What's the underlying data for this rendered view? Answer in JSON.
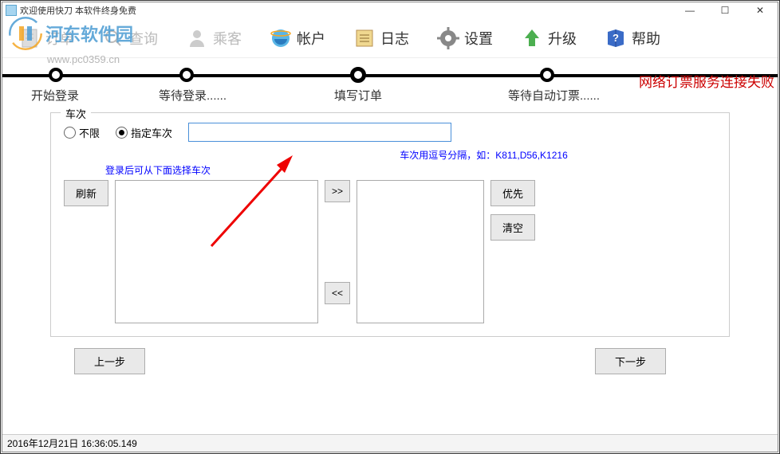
{
  "window": {
    "title": "欢迎使用快刀  本软件终身免费"
  },
  "toolbar": {
    "order": "订单",
    "query": "查询",
    "passenger": "乘客",
    "account": "帐户",
    "log": "日志",
    "settings": "设置",
    "upgrade": "升级",
    "help": "帮助"
  },
  "watermark": {
    "brand": "河东软件园",
    "url": "www.pc0359.cn"
  },
  "stepper": {
    "s1": "开始登录",
    "s2": "等待登录......",
    "s3": "填写订单",
    "s4": "等待自动订票......",
    "status": "网络订票服务连接失败"
  },
  "panel": {
    "legend": "车次",
    "opt_any": "不限",
    "opt_spec": "指定车次",
    "train_input": "",
    "hint_sep": "车次用逗号分隔，如：K811,D56,K1216",
    "hint_login": "登录后可从下面选择车次",
    "refresh": "刷新",
    "move_right": ">>",
    "move_left": "<<",
    "priority": "优先",
    "clear": "清空"
  },
  "nav": {
    "prev": "上一步",
    "next": "下一步"
  },
  "status": {
    "time": "2016年12月21日 16:36:05.149"
  }
}
